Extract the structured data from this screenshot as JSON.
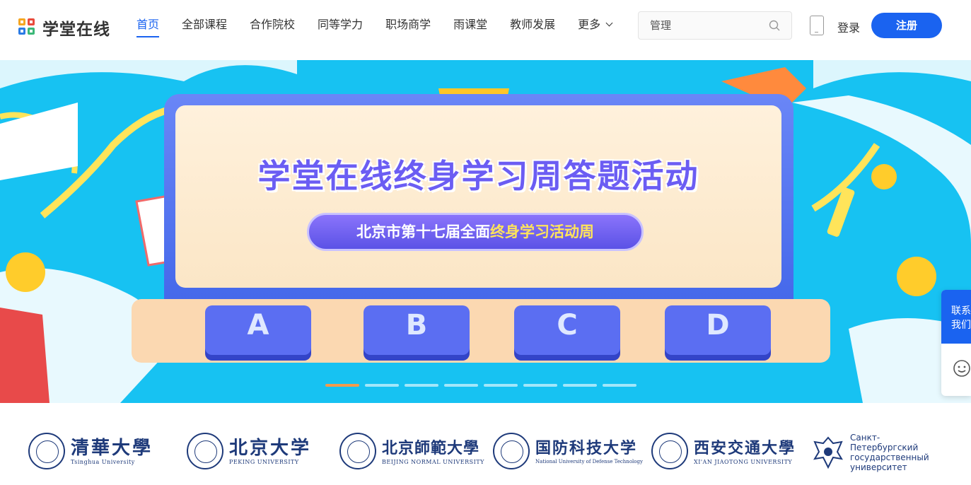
{
  "header": {
    "logo_text": "学堂在线",
    "nav": [
      {
        "label": "首页",
        "active": true
      },
      {
        "label": "全部课程"
      },
      {
        "label": "合作院校"
      },
      {
        "label": "同等学力"
      },
      {
        "label": "职场商学"
      },
      {
        "label": "雨课堂"
      },
      {
        "label": "教师发展"
      },
      {
        "label": "更多"
      }
    ],
    "search": {
      "value": "",
      "placeholder": "管理"
    },
    "login_label": "登录",
    "register_label": "注册",
    "accent_color": "#1a63f0"
  },
  "banner": {
    "headline": "学堂在线终身学习周答题活动",
    "subtitle_plain": "北京市第十七届全面",
    "subtitle_highlight": "终身学习活动周",
    "answer_keys": [
      "A",
      "B",
      "C",
      "D"
    ],
    "carousel": {
      "total": 8,
      "active": 1
    },
    "side_contact_label": "联系我们",
    "background_color": "#17c2f2"
  },
  "partners": [
    {
      "name_cn": "清華大學",
      "name_en": "Tsinghua University"
    },
    {
      "name_cn": "北京大学",
      "name_en": "PEKING UNIVERSITY"
    },
    {
      "name_cn": "北京師範大學",
      "name_en": "BEIJING NORMAL UNIVERSITY"
    },
    {
      "name_cn": "国防科技大学",
      "name_en": "National University of Defense Technology"
    },
    {
      "name_cn": "西安交通大學",
      "name_en": "XI'AN JIAOTONG UNIVERSITY"
    },
    {
      "name_ru": "Санкт-Петербургский государственный университет"
    }
  ]
}
